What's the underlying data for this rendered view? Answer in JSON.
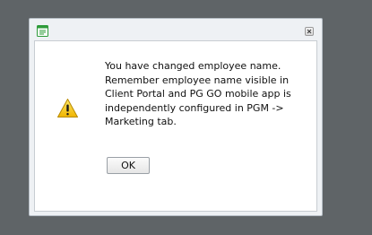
{
  "dialog": {
    "app_icon": "app-window-icon",
    "close_icon": "close-icon",
    "warning_icon": "warning-icon",
    "message_lines": [
      "You have changed employee name.",
      "Remember employee name visible in",
      "Client Portal and PG GO mobile app is",
      "independently configured in PGM ->",
      "Marketing tab."
    ],
    "ok_label": "OK"
  },
  "colors": {
    "background": "#5f6467",
    "dialog_frame": "#eef1f4",
    "content_bg": "#ffffff",
    "app_icon_green": "#2e9b3a",
    "warning_yellow": "#f5c518"
  }
}
